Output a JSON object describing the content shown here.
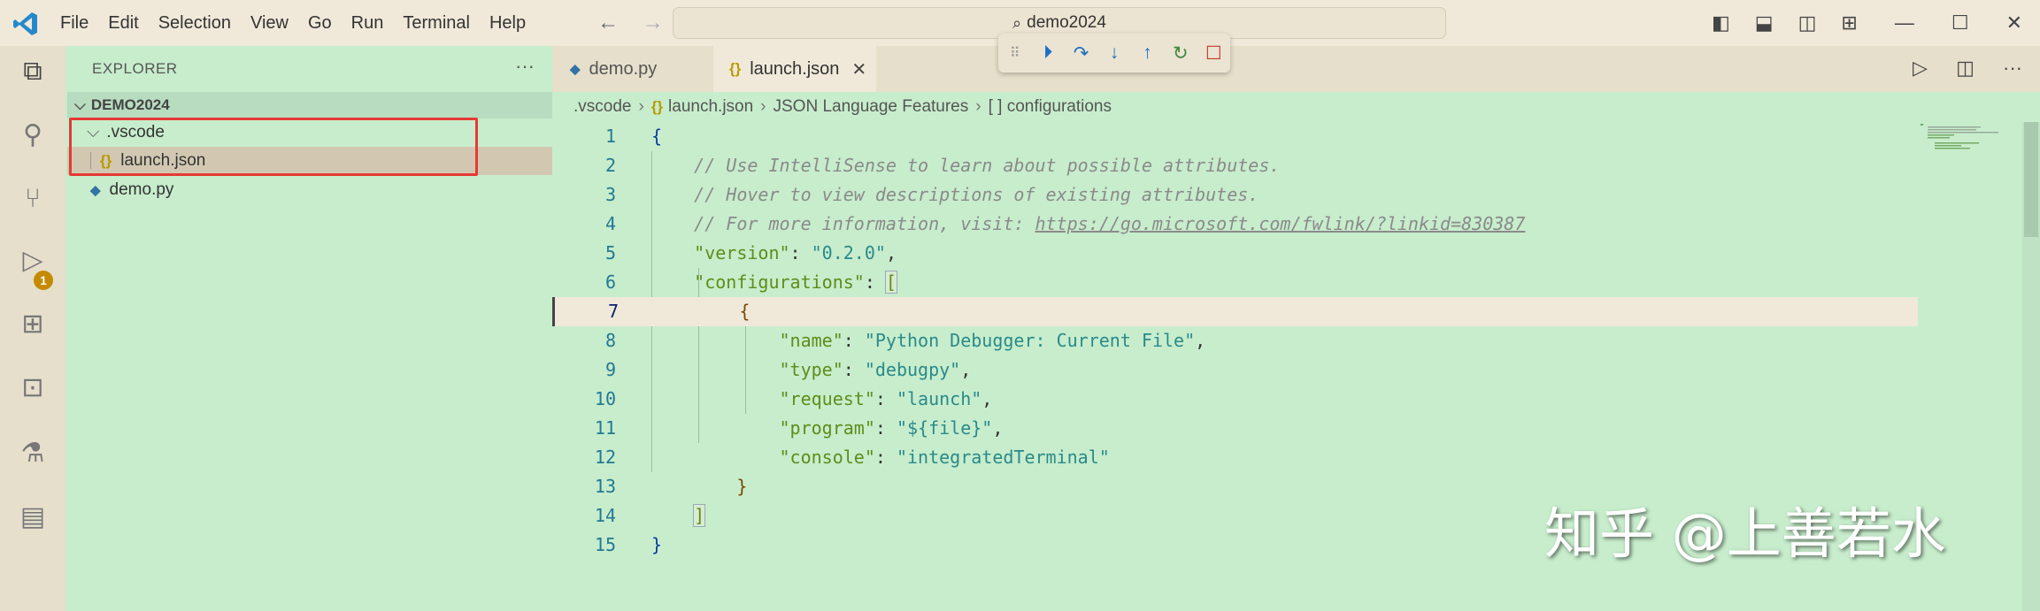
{
  "menu": [
    "File",
    "Edit",
    "Selection",
    "View",
    "Go",
    "Run",
    "Terminal",
    "Help"
  ],
  "search": {
    "text": "demo2024"
  },
  "explorer": {
    "title": "EXPLORER",
    "more": "···",
    "folder": "DEMO2024",
    "items": [
      {
        "label": ".vscode",
        "type": "folder"
      },
      {
        "label": "launch.json",
        "type": "json"
      },
      {
        "label": "demo.py",
        "type": "python"
      }
    ]
  },
  "activity": {
    "badge": "1"
  },
  "tabs": [
    {
      "label": "demo.py",
      "active": false
    },
    {
      "label": "launch.json",
      "active": true
    }
  ],
  "breadcrumb": [
    ".vscode",
    "launch.json",
    "JSON Language Features",
    "[ ] configurations"
  ],
  "code": {
    "lines": [
      "1",
      "2",
      "3",
      "4",
      "5",
      "6",
      "7",
      "8",
      "9",
      "10",
      "11",
      "12",
      "13",
      "14",
      "15"
    ],
    "comment1": "// Use IntelliSense to learn about possible attributes.",
    "comment2": "// Hover to view descriptions of existing attributes.",
    "comment3_prefix": "// For more information, visit: ",
    "comment3_link": "https://go.microsoft.com/fwlink/?linkid=830387",
    "version_key": "\"version\"",
    "version_val": "\"0.2.0\"",
    "configurations_key": "\"configurations\"",
    "name_key": "\"name\"",
    "name_val": "\"Python Debugger: Current File\"",
    "type_key": "\"type\"",
    "type_val": "\"debugpy\"",
    "request_key": "\"request\"",
    "request_val": "\"launch\"",
    "program_key": "\"program\"",
    "program_val": "\"${file}\"",
    "console_key": "\"console\"",
    "console_val": "\"integratedTerminal\""
  },
  "watermark": "知乎 @上善若水",
  "colors": {
    "background": "#c7edcc",
    "titlebar": "#f0e9da",
    "highlight_box": "#e53935"
  }
}
